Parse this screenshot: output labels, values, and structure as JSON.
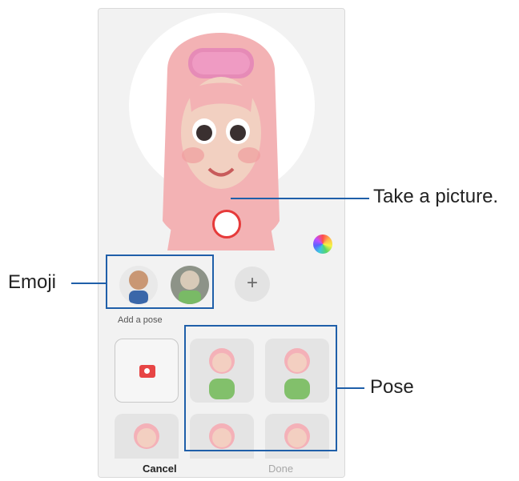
{
  "screen": {
    "section_label": "Add a pose",
    "cancel_label": "Cancel",
    "done_label": "Done",
    "add_emoji_symbol": "+"
  },
  "callouts": {
    "take_picture": "Take a picture.",
    "emoji": "Emoji",
    "pose": "Pose"
  },
  "colors": {
    "accent": "#1f5fa9",
    "shutter": "#e63a3a",
    "hair": "#f3b2b4",
    "skin": "#f2d0c1",
    "pose_bg": "#e4e4e4"
  }
}
